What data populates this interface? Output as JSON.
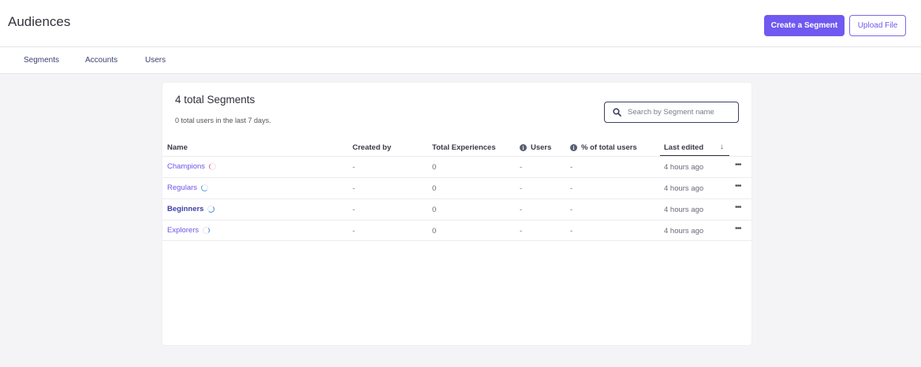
{
  "header": {
    "title": "Audiences",
    "create_button": "Create a Segment",
    "upload_button": "Upload File"
  },
  "tabs": [
    {
      "label": "Segments"
    },
    {
      "label": "Accounts"
    },
    {
      "label": "Users"
    }
  ],
  "card": {
    "title": "4 total Segments",
    "subtitle": "0 total users in the last 7 days.",
    "search_placeholder": "Search by Segment name"
  },
  "table": {
    "columns": {
      "name": "Name",
      "created_by": "Created by",
      "total_experiences": "Total Experiences",
      "users": "Users",
      "pct_users": "% of total users",
      "last_edited": "Last edited"
    },
    "rows": [
      {
        "name": "Champions",
        "created_by": "-",
        "total_experiences": "0",
        "users": "-",
        "pct_users": "-",
        "last_edited": "4 hours ago",
        "spinner_color": "#e0607a"
      },
      {
        "name": "Regulars",
        "created_by": "-",
        "total_experiences": "0",
        "users": "-",
        "pct_users": "-",
        "last_edited": "4 hours ago",
        "spinner_color": "#4da0e8"
      },
      {
        "name": "Beginners",
        "created_by": "-",
        "total_experiences": "0",
        "users": "-",
        "pct_users": "-",
        "last_edited": "4 hours ago",
        "spinner_color": "#3b8fe0"
      },
      {
        "name": "Explorers",
        "created_by": "-",
        "total_experiences": "0",
        "users": "-",
        "pct_users": "-",
        "last_edited": "4 hours ago",
        "spinner_color": "#3b8fe0"
      }
    ]
  },
  "colors": {
    "accent": "#7059f0",
    "link": "#6b55e8"
  }
}
